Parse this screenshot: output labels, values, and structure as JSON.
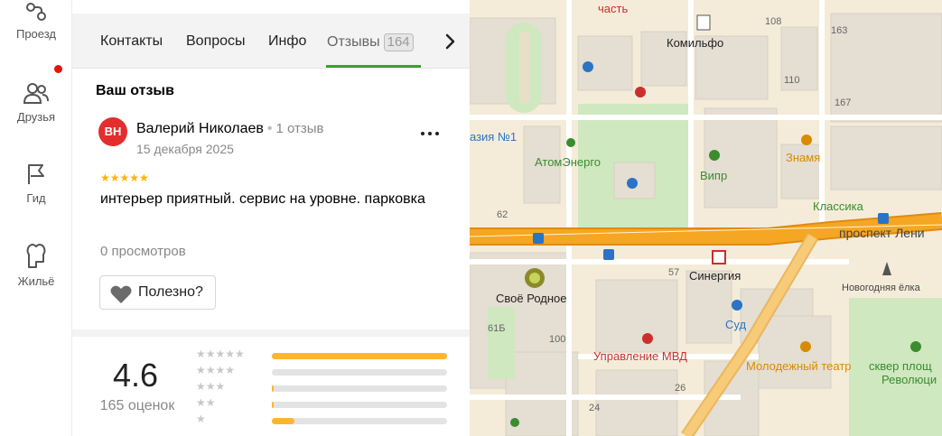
{
  "rail": {
    "items": [
      {
        "label": "Проезд"
      },
      {
        "label": "Друзья"
      },
      {
        "label": "Гид"
      },
      {
        "label": "Жильё"
      }
    ]
  },
  "tabs": {
    "items": [
      {
        "label": "Контакты"
      },
      {
        "label": "Вопросы"
      },
      {
        "label": "Инфо"
      },
      {
        "label": "Отзывы",
        "count": "164"
      }
    ],
    "active": "Отзывы"
  },
  "review_section": {
    "title": "Ваш отзыв"
  },
  "review": {
    "avatar_initials": "ВН",
    "author": "Валерий Николаев",
    "author_reviews": "1 отзыв",
    "date": "15 декабря 2025",
    "stars": "★★★★★",
    "rating": 5,
    "text": "интерьер приятный. сервис на уровне. парковка",
    "views": "0 просмотров",
    "useful_label": "Полезно?"
  },
  "summary": {
    "rating": "4.6",
    "count_label": "165 оценок",
    "distribution": [
      {
        "stars": "★★★★★",
        "fraction": 1.0
      },
      {
        "stars": "★★★★",
        "fraction": 0.0
      },
      {
        "stars": "★★★",
        "fraction": 0.01
      },
      {
        "stars": "★★",
        "fraction": 0.01
      },
      {
        "stars": "★",
        "fraction": 0.13
      }
    ]
  },
  "map": {
    "labels": {
      "chast": "часть",
      "komilfo": "Комильфо",
      "n108": "108",
      "n163": "163",
      "n110": "110",
      "n167": "167",
      "gimnaziya": "азия №1",
      "atomenergo": "АтомЭнерго",
      "vipr": "Випр",
      "znamya": "Знамя",
      "klassika": "Классика",
      "n62": "62",
      "prospekt": "проспект Лени",
      "svoe_rodnoe": "Своё Родное",
      "n57": "57",
      "sinergiya": "Синергия",
      "novogodnyaya": "Новогодняя ёлка",
      "sud": "Суд",
      "n61b": "61Б",
      "n100": "100",
      "mvd": "Управление МВД",
      "teatr": "Молодежный театр",
      "skver1": "сквер площ",
      "skver2": "Революци",
      "n26": "26",
      "n24": "24"
    },
    "colors": {
      "road_main": "#f5a623",
      "road_main_edge": "#e08a10",
      "block": "#e4ded3",
      "park": "#cfe8c0",
      "red_label": "#c9302c",
      "green_label": "#3b8c2f",
      "blue_label": "#2b73c4",
      "orange_label": "#d98b00"
    }
  }
}
